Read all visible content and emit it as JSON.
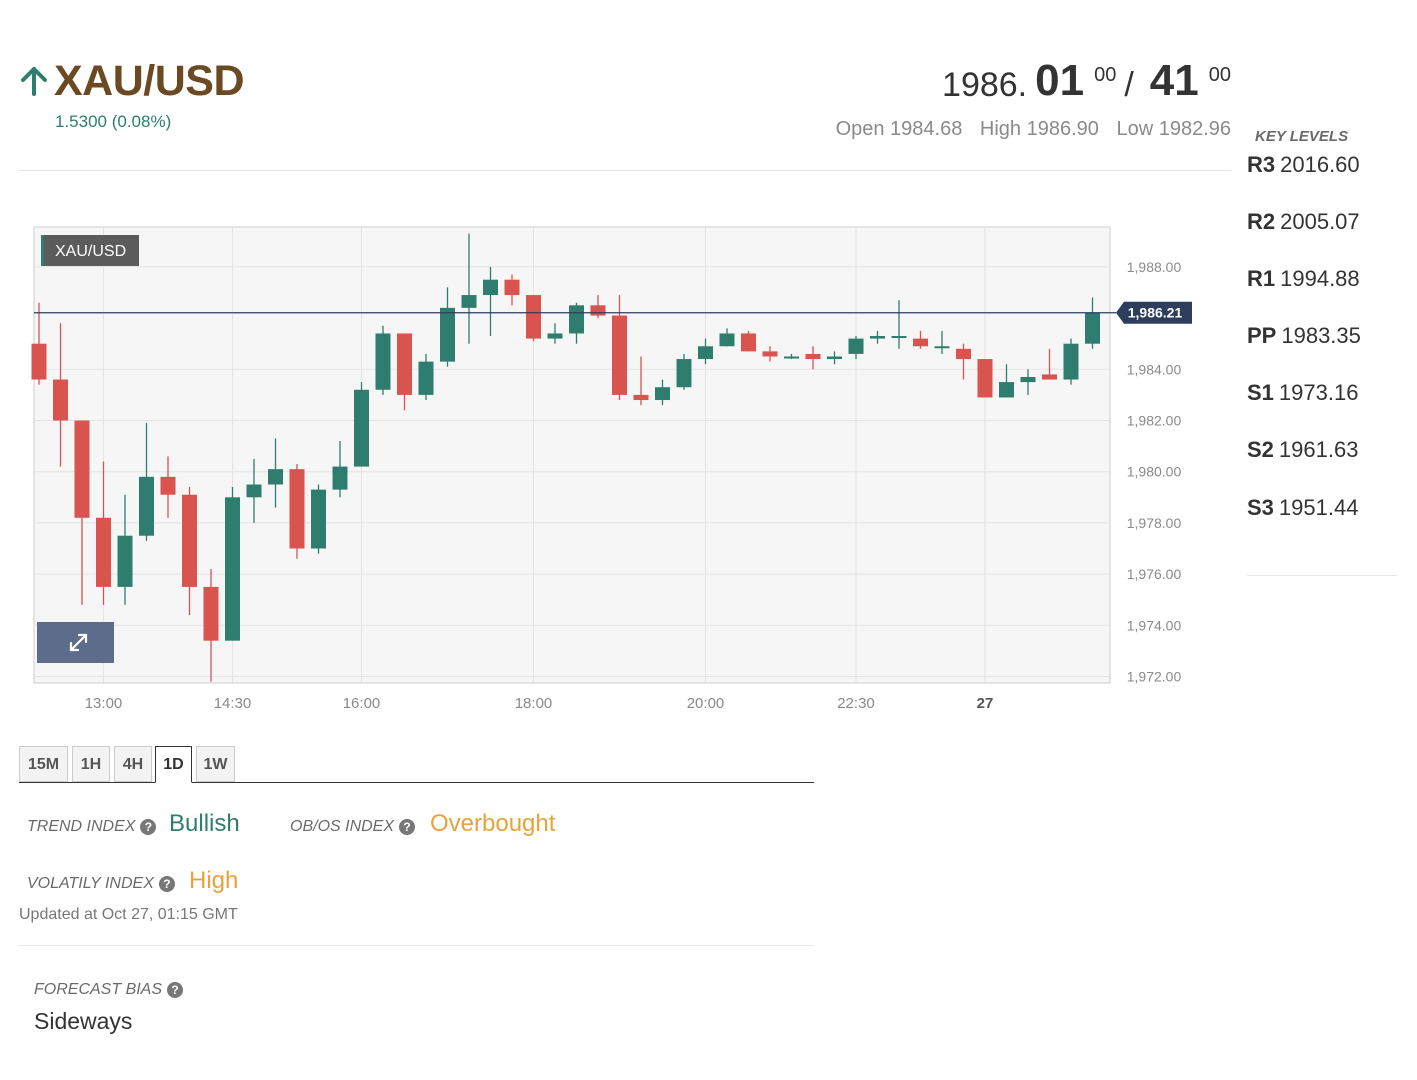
{
  "instrument": {
    "symbol": "XAU/USD",
    "change": "1.5300 (0.08%)",
    "direction_icon": "arrow-up-icon"
  },
  "quote": {
    "bid_int": "1986.",
    "bid_big": "01",
    "bid_small": "00",
    "separator": "/",
    "ask_big": "41",
    "ask_small": "00"
  },
  "ohl": {
    "open": "Open 1984.68",
    "high": "High 1986.90",
    "low": "Low 1982.96"
  },
  "key_levels": {
    "title": "KEY LEVELS",
    "levels": [
      {
        "name": "R3",
        "value": "2016.60"
      },
      {
        "name": "R2",
        "value": "2005.07"
      },
      {
        "name": "R1",
        "value": "1994.88"
      },
      {
        "name": "PP",
        "value": "1983.35"
      },
      {
        "name": "S1",
        "value": "1973.16"
      },
      {
        "name": "S2",
        "value": "1961.63"
      },
      {
        "name": "S3",
        "value": "1951.44"
      }
    ]
  },
  "chart_data": {
    "type": "candlestick",
    "legend": "XAU/USD",
    "current_price_label": "1,986.21",
    "current_price": 1986.21,
    "ylim": [
      1972,
      1989.5
    ],
    "y_ticks": [
      {
        "value": 1988,
        "label": "1,988.00"
      },
      {
        "value": 1984,
        "label": "1,984.00"
      },
      {
        "value": 1982,
        "label": "1,982.00"
      },
      {
        "value": 1980,
        "label": "1,980.00"
      },
      {
        "value": 1978,
        "label": "1,978.00"
      },
      {
        "value": 1976,
        "label": "1,976.00"
      },
      {
        "value": 1974,
        "label": "1,974.00"
      },
      {
        "value": 1972,
        "label": "1,972.00"
      }
    ],
    "x_ticks": [
      {
        "index": 3,
        "label": "13:00",
        "bold": false
      },
      {
        "index": 9,
        "label": "14:30",
        "bold": false
      },
      {
        "index": 15,
        "label": "16:00",
        "bold": false
      },
      {
        "index": 23,
        "label": "18:00",
        "bold": false
      },
      {
        "index": 31,
        "label": "20:00",
        "bold": false
      },
      {
        "index": 38,
        "label": "22:30",
        "bold": false
      },
      {
        "index": 44,
        "label": "27",
        "bold": true
      }
    ],
    "candles": [
      {
        "o": 1985.0,
        "h": 1986.6,
        "l": 1983.4,
        "c": 1983.6
      },
      {
        "o": 1983.6,
        "h": 1985.8,
        "l": 1980.2,
        "c": 1982.0
      },
      {
        "o": 1982.0,
        "h": 1982.0,
        "l": 1974.8,
        "c": 1978.2
      },
      {
        "o": 1978.2,
        "h": 1980.4,
        "l": 1974.8,
        "c": 1975.5
      },
      {
        "o": 1975.5,
        "h": 1979.1,
        "l": 1974.8,
        "c": 1977.5
      },
      {
        "o": 1977.5,
        "h": 1981.9,
        "l": 1977.3,
        "c": 1979.8
      },
      {
        "o": 1979.8,
        "h": 1980.6,
        "l": 1978.2,
        "c": 1979.1
      },
      {
        "o": 1979.1,
        "h": 1979.4,
        "l": 1974.4,
        "c": 1975.5
      },
      {
        "o": 1975.5,
        "h": 1976.2,
        "l": 1971.8,
        "c": 1973.4
      },
      {
        "o": 1973.4,
        "h": 1979.4,
        "l": 1973.4,
        "c": 1979.0
      },
      {
        "o": 1979.0,
        "h": 1980.5,
        "l": 1978.0,
        "c": 1979.5
      },
      {
        "o": 1979.5,
        "h": 1981.3,
        "l": 1978.6,
        "c": 1980.1
      },
      {
        "o": 1980.1,
        "h": 1980.3,
        "l": 1976.6,
        "c": 1977.0
      },
      {
        "o": 1977.0,
        "h": 1979.5,
        "l": 1976.8,
        "c": 1979.3
      },
      {
        "o": 1979.3,
        "h": 1981.2,
        "l": 1979.0,
        "c": 1980.2
      },
      {
        "o": 1980.2,
        "h": 1983.5,
        "l": 1980.2,
        "c": 1983.2
      },
      {
        "o": 1983.2,
        "h": 1985.7,
        "l": 1983.0,
        "c": 1985.4
      },
      {
        "o": 1985.4,
        "h": 1985.4,
        "l": 1982.4,
        "c": 1983.0
      },
      {
        "o": 1983.0,
        "h": 1984.6,
        "l": 1982.8,
        "c": 1984.3
      },
      {
        "o": 1984.3,
        "h": 1987.2,
        "l": 1984.1,
        "c": 1986.4
      },
      {
        "o": 1986.4,
        "h": 1989.3,
        "l": 1985.0,
        "c": 1986.9
      },
      {
        "o": 1986.9,
        "h": 1988.0,
        "l": 1985.3,
        "c": 1987.5
      },
      {
        "o": 1987.5,
        "h": 1987.7,
        "l": 1986.5,
        "c": 1986.9
      },
      {
        "o": 1986.9,
        "h": 1986.9,
        "l": 1985.1,
        "c": 1985.2
      },
      {
        "o": 1985.2,
        "h": 1985.8,
        "l": 1985.0,
        "c": 1985.4
      },
      {
        "o": 1985.4,
        "h": 1986.6,
        "l": 1985.0,
        "c": 1986.5
      },
      {
        "o": 1986.5,
        "h": 1986.9,
        "l": 1986.0,
        "c": 1986.1
      },
      {
        "o": 1986.1,
        "h": 1986.9,
        "l": 1982.8,
        "c": 1983.0
      },
      {
        "o": 1983.0,
        "h": 1984.5,
        "l": 1982.6,
        "c": 1982.8
      },
      {
        "o": 1982.8,
        "h": 1983.6,
        "l": 1982.6,
        "c": 1983.3
      },
      {
        "o": 1983.3,
        "h": 1984.6,
        "l": 1983.2,
        "c": 1984.4
      },
      {
        "o": 1984.4,
        "h": 1985.2,
        "l": 1984.2,
        "c": 1984.9
      },
      {
        "o": 1984.9,
        "h": 1985.6,
        "l": 1984.9,
        "c": 1985.4
      },
      {
        "o": 1985.4,
        "h": 1985.5,
        "l": 1984.7,
        "c": 1984.7
      },
      {
        "o": 1984.7,
        "h": 1984.9,
        "l": 1984.3,
        "c": 1984.5
      },
      {
        "o": 1984.5,
        "h": 1984.6,
        "l": 1984.4,
        "c": 1984.5
      },
      {
        "o": 1984.6,
        "h": 1984.9,
        "l": 1984.0,
        "c": 1984.4
      },
      {
        "o": 1984.4,
        "h": 1984.7,
        "l": 1984.2,
        "c": 1984.5
      },
      {
        "o": 1984.6,
        "h": 1985.3,
        "l": 1984.4,
        "c": 1985.2
      },
      {
        "o": 1985.2,
        "h": 1985.5,
        "l": 1985.0,
        "c": 1985.3
      },
      {
        "o": 1985.3,
        "h": 1986.7,
        "l": 1984.8,
        "c": 1985.3
      },
      {
        "o": 1985.2,
        "h": 1985.5,
        "l": 1984.8,
        "c": 1984.9
      },
      {
        "o": 1984.9,
        "h": 1985.5,
        "l": 1984.6,
        "c": 1984.9
      },
      {
        "o": 1984.8,
        "h": 1985.0,
        "l": 1983.6,
        "c": 1984.4
      },
      {
        "o": 1984.4,
        "h": 1984.4,
        "l": 1982.9,
        "c": 1982.9
      },
      {
        "o": 1982.9,
        "h": 1984.2,
        "l": 1982.9,
        "c": 1983.5
      },
      {
        "o": 1983.5,
        "h": 1984.0,
        "l": 1983.0,
        "c": 1983.7
      },
      {
        "o": 1983.8,
        "h": 1984.8,
        "l": 1983.6,
        "c": 1983.6
      },
      {
        "o": 1983.6,
        "h": 1985.2,
        "l": 1983.4,
        "c": 1985.0
      },
      {
        "o": 1985.0,
        "h": 1986.8,
        "l": 1984.8,
        "c": 1986.2
      }
    ],
    "colors": {
      "up": "#2e7d6e",
      "down": "#d9534f",
      "price_line": "#2d3e5c"
    }
  },
  "timeframes": {
    "tabs": [
      "15M",
      "1H",
      "4H",
      "1D",
      "1W"
    ],
    "active": "1D"
  },
  "indices": {
    "trend_label": "TREND INDEX",
    "trend_value": "Bullish",
    "obos_label": "OB/OS INDEX",
    "obos_value": "Overbought",
    "volatility_label": "VOLATILY INDEX",
    "volatility_value": "High",
    "help_icon": "question-circle-icon"
  },
  "updated": "Updated at Oct 27, 01:15 GMT",
  "forecast": {
    "label": "FORECAST BIAS",
    "value": "Sideways"
  }
}
